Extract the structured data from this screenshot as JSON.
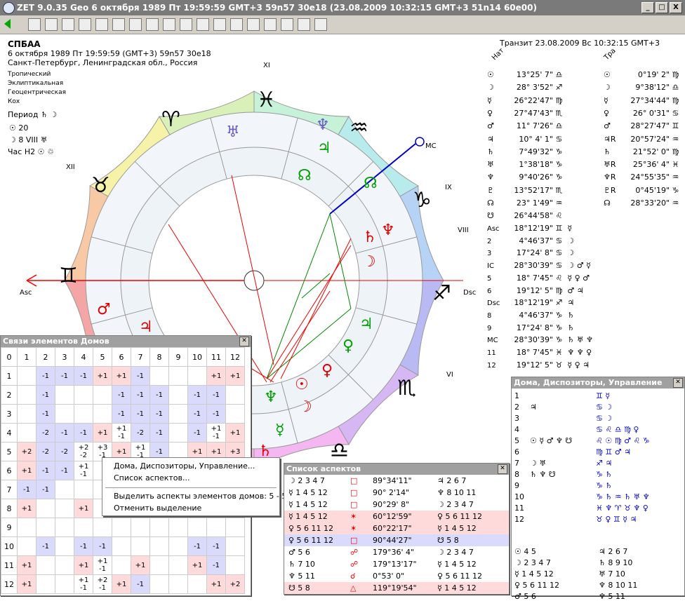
{
  "window": {
    "title": "ZET 9.0.35 Geo    6 октября 1989  Пт  19:59:59 GMT+3 59n57  30e18  (23.08.2009  10:32:15 GMT+3 51n14 60e00)",
    "min": "_",
    "max": "□",
    "close": "X"
  },
  "header": {
    "name": "СПБАА",
    "date_line": "6 октября 1989   Пт   19:59:59 (GMT+3)  59n57  30e18",
    "place": "Санкт-Петербург, Ленинградская обл., Россия",
    "settings": [
      "Тропический",
      "Эклиптикальная",
      "Геоцентрическая",
      "Кох"
    ],
    "period_label": "Период ♄ ☽",
    "sun_line": "☉  20",
    "moon_line": "☽  8 VIII ♅",
    "hour_label": "Час H2 ☉ ♲",
    "transit": "Транзит 23.08.2009   Вс 10:32:15 GMT+3"
  },
  "chart": {
    "houses": [
      "XI",
      "XII",
      "IX",
      "VIII",
      "VI"
    ],
    "asc": "Asc",
    "dsc": "Dsc",
    "mc": "MC",
    "signs": [
      "♓",
      "♈",
      "♉",
      "♊",
      "♒",
      "♑",
      "♐",
      "♏",
      "♎"
    ],
    "planets_green": [
      "♅",
      "♆",
      "♃",
      "☊",
      "☊",
      "♃",
      "♀",
      "♆",
      "☿"
    ],
    "planets_red": [
      "♆",
      "♄",
      "☽",
      "♂",
      "♃",
      "♀",
      "☉",
      "☽",
      "♄"
    ],
    "r": "R"
  },
  "positions": {
    "nat_header": "Нат",
    "tra_header": "Тра",
    "nat": [
      [
        "☉",
        "13°25' 7\"",
        "♎"
      ],
      [
        "☽",
        "28° 3'52\"",
        "♐"
      ],
      [
        "☿",
        "26°22'47\"",
        "♍"
      ],
      [
        "♀",
        "27°47'43\"",
        "♏"
      ],
      [
        "♂",
        "11° 7'26\"",
        "♎"
      ],
      [
        "♃",
        "10° 4' 1\"",
        "♋"
      ],
      [
        "♄",
        "7°49'32\"",
        "♑"
      ],
      [
        "♅",
        "1°38'18\"",
        "♑"
      ],
      [
        "♆",
        "9°40'26\"",
        "♑"
      ],
      [
        "♇",
        "13°52'17\"",
        "♏"
      ],
      [
        "☊",
        "23° 1'49\"",
        "♒"
      ],
      [
        "☋",
        "26°44'58\"",
        "♌"
      ]
    ],
    "tra": [
      [
        "☉",
        "0°19' 2\"",
        "♍"
      ],
      [
        "☽",
        "9°38'12\"",
        "♎"
      ],
      [
        "☿",
        "27°34'44\"",
        "♍"
      ],
      [
        "♀",
        "26° 0'31\"",
        "♋"
      ],
      [
        "♂",
        "28°27'47\"",
        "♊"
      ],
      [
        "♃R",
        "20°57'24\"",
        "♒"
      ],
      [
        "♄",
        "21°52' 0\"",
        "♍"
      ],
      [
        "♅R",
        "25°36' 4\"",
        "♓"
      ],
      [
        "♆R",
        "24°55'35\"",
        "♒"
      ],
      [
        "♇R",
        "0°45'19\"",
        "♑"
      ],
      [
        "☊",
        "28°33'20\"",
        "♒"
      ]
    ],
    "cusps": [
      [
        "Asc",
        "18°12'19\"",
        "♊",
        "☿"
      ],
      [
        "2",
        "4°46'37\"",
        "♋",
        "☽"
      ],
      [
        "3",
        "17°24' 8\"",
        "♋",
        "☽"
      ],
      [
        "IC",
        "28°30'39\"",
        "♋",
        "☽ ♂ ☿"
      ],
      [
        "5",
        "18° 7'45\"",
        "♌",
        "☿ ♀ ♂"
      ],
      [
        "6",
        "19°12' 5\"",
        "♍",
        "♂ ♃"
      ],
      [
        "Dsc",
        "18°12'19\"",
        "♐",
        "♃"
      ],
      [
        "8",
        "4°46'37\"",
        "♑",
        "♄"
      ],
      [
        "9",
        "17°24' 8\"",
        "♑",
        "♄"
      ],
      [
        "MC",
        "28°30'39\"",
        "♑",
        "♄ ♅ ♆"
      ],
      [
        "11",
        "18° 7'45\"",
        "♓",
        "♆ ♆ ♀"
      ],
      [
        "12",
        "19°12' 5\"",
        "♉",
        "☿ ♀ ♃"
      ]
    ]
  },
  "houses_panel": {
    "title": "Связи элементов Домов",
    "corner": "0",
    "cols": [
      "1",
      "2",
      "3",
      "4",
      "5",
      "6",
      "7",
      "8",
      "9",
      "10",
      "11",
      "12"
    ],
    "rows": [
      {
        "h": "1",
        "c": [
          [
            "",
            ""
          ],
          [
            "",
            "-1"
          ],
          [
            "",
            "-1"
          ],
          [
            "",
            "-1"
          ],
          [
            "+1",
            ""
          ],
          [
            "+1",
            ""
          ],
          [
            "",
            "-1"
          ],
          [
            "",
            ""
          ],
          [
            "",
            ""
          ],
          [
            "",
            ""
          ],
          [
            "+1",
            ""
          ],
          [
            "+1",
            ""
          ]
        ]
      },
      {
        "h": "2",
        "c": [
          [
            "",
            ""
          ],
          [
            "",
            "-1"
          ],
          [
            "",
            ""
          ],
          [
            "",
            ""
          ],
          [
            "",
            ""
          ],
          [
            "",
            "-1"
          ],
          [
            "",
            "-1"
          ],
          [
            "",
            "-1"
          ],
          [
            "",
            ""
          ],
          [
            "",
            "-1"
          ],
          [
            "",
            "-1"
          ],
          [
            "",
            ""
          ]
        ]
      },
      {
        "h": "3",
        "c": [
          [
            "",
            ""
          ],
          [
            "",
            "-1"
          ],
          [
            "",
            ""
          ],
          [
            "",
            ""
          ],
          [
            "",
            ""
          ],
          [
            "",
            "-1"
          ],
          [
            "",
            "-1"
          ],
          [
            "",
            "-1"
          ],
          [
            "",
            ""
          ],
          [
            "",
            "-1"
          ],
          [
            "",
            "-1"
          ],
          [
            "",
            ""
          ]
        ]
      },
      {
        "h": "4",
        "c": [
          [
            "",
            ""
          ],
          [
            "",
            "-2"
          ],
          [
            "",
            "-1"
          ],
          [
            "",
            "-1"
          ],
          [
            "+1",
            ""
          ],
          [
            "+1",
            "-1"
          ],
          [
            "",
            "-2"
          ],
          [
            "",
            "-1"
          ],
          [
            "",
            ""
          ],
          [
            "",
            "-1"
          ],
          [
            "+1",
            "-1"
          ],
          [
            "+1",
            ""
          ]
        ]
      },
      {
        "h": "5",
        "c": [
          [
            "+2",
            ""
          ],
          [
            "",
            "-2"
          ],
          [
            "",
            "-2"
          ],
          [
            "+2",
            "-2"
          ],
          [
            "+3",
            "-1"
          ],
          [
            "+1",
            ""
          ],
          [
            "+1",
            "-1"
          ],
          [
            "",
            "-1"
          ],
          [
            "",
            ""
          ],
          [
            "+1",
            ""
          ],
          [
            "+1",
            ""
          ],
          [
            "+3",
            ""
          ]
        ]
      },
      {
        "h": "6",
        "c": [
          [
            "+1",
            ""
          ],
          [
            "",
            "-1"
          ],
          [
            "",
            "-1"
          ],
          [
            "+1",
            "-1"
          ],
          [
            "",
            ""
          ],
          [
            "",
            ""
          ],
          [
            "",
            ""
          ],
          [
            "",
            ""
          ],
          [
            "",
            ""
          ],
          [
            "",
            ""
          ],
          [
            "",
            ""
          ],
          [
            "",
            ""
          ]
        ]
      },
      {
        "h": "7",
        "c": [
          [
            "",
            "-1"
          ],
          [
            "",
            "-1"
          ],
          [
            "",
            ""
          ],
          [
            "",
            ""
          ],
          [
            "",
            ""
          ],
          [
            "",
            ""
          ],
          [
            "",
            ""
          ],
          [
            "",
            ""
          ],
          [
            "",
            ""
          ],
          [
            "",
            ""
          ],
          [
            "",
            ""
          ],
          [
            "",
            ""
          ]
        ]
      },
      {
        "h": "8",
        "c": [
          [
            "+1",
            ""
          ],
          [
            "",
            ""
          ],
          [
            "",
            ""
          ],
          [
            "+1",
            ""
          ],
          [
            "",
            ""
          ],
          [
            "",
            ""
          ],
          [
            "",
            ""
          ],
          [
            "",
            ""
          ],
          [
            "",
            ""
          ],
          [
            "",
            ""
          ],
          [
            "",
            ""
          ],
          [
            "",
            ""
          ]
        ]
      },
      {
        "h": "9",
        "c": [
          [
            "",
            ""
          ],
          [
            "",
            ""
          ],
          [
            "",
            ""
          ],
          [
            "",
            ""
          ],
          [
            "",
            ""
          ],
          [
            "",
            ""
          ],
          [
            "",
            ""
          ],
          [
            "",
            ""
          ],
          [
            "",
            ""
          ],
          [
            "",
            ""
          ],
          [
            "",
            ""
          ],
          [
            "",
            ""
          ]
        ]
      },
      {
        "h": "10",
        "c": [
          [
            "",
            ""
          ],
          [
            "",
            "-1"
          ],
          [
            "",
            ""
          ],
          [
            "",
            "-1"
          ],
          [
            "",
            "-1"
          ],
          [
            "",
            ""
          ],
          [
            "",
            ""
          ],
          [
            "",
            ""
          ],
          [
            "",
            ""
          ],
          [
            "",
            "-1"
          ],
          [
            "",
            "-1"
          ],
          [
            "",
            ""
          ]
        ]
      },
      {
        "h": "11",
        "c": [
          [
            "+1",
            ""
          ],
          [
            "",
            ""
          ],
          [
            "",
            ""
          ],
          [
            "+1",
            ""
          ],
          [
            "+1",
            "-1"
          ],
          [
            "",
            ""
          ],
          [
            "+1",
            ""
          ],
          [
            "",
            ""
          ],
          [
            "",
            ""
          ],
          [
            "+1",
            ""
          ],
          [
            "",
            "-1"
          ],
          [
            "",
            ""
          ]
        ]
      },
      {
        "h": "12",
        "c": [
          [
            "+1",
            ""
          ],
          [
            "",
            ""
          ],
          [
            "",
            ""
          ],
          [
            "+1",
            "-1"
          ],
          [
            "+2",
            "-1"
          ],
          [
            "+1",
            ""
          ],
          [
            "",
            "-1"
          ],
          [
            "",
            ""
          ],
          [
            "",
            ""
          ],
          [
            "",
            ""
          ],
          [
            "+1",
            ""
          ],
          [
            "+2",
            ""
          ]
        ]
      }
    ]
  },
  "context_menu": {
    "item1": "Дома, Диспозиторы, Управление...",
    "item2": "Список аспектов...",
    "item3": "Выделить аспекты элементов домов: 5 - 5",
    "item4": "Отменить выделение"
  },
  "aspects_panel": {
    "title": "Список аспектов",
    "rows": [
      [
        "☽ 2 3 4 7",
        "□",
        "89°34'11\"",
        "♃ 2 6 7",
        ""
      ],
      [
        "☿ 1 4 5 12",
        "□",
        "90° 2'14\"",
        "♆ 8 10 11",
        ""
      ],
      [
        "☿ 1 4 5 12",
        "□",
        "90°29' 8\"",
        "☽ 2 3 4 7",
        ""
      ],
      [
        "☿ 1 4 5 12",
        "✶",
        "60°12'59\"",
        "♀ 5 6 11 12",
        "pos"
      ],
      [
        "♀ 5 6 11 12",
        "✶",
        "60°22'17\"",
        "☿ 1 4 5 12",
        "pos"
      ],
      [
        "♀ 5 6 11 12",
        "□",
        "90°44'27\"",
        "☋ 5 8",
        "neg"
      ],
      [
        "♂ 5 6",
        "☍",
        "179°36' 4\"",
        "☽ 2 3 4 7",
        ""
      ],
      [
        "♄ 7 10",
        "☍",
        "179°13'17\"",
        "☿ 1 4 5 12",
        ""
      ],
      [
        "♆ 5 11",
        "☌",
        "0°53' 0\"",
        "♀ 5 6 11 12",
        ""
      ],
      [
        "☋ 5 8",
        "△",
        "119°19'54\"",
        "☿ 1 4 5 12",
        "pos"
      ]
    ]
  },
  "disp_panel": {
    "title": "Дома, Диспозиторы, Управление",
    "rows": [
      [
        "1",
        "♊ ☿"
      ],
      [
        "2",
        "♃",
        "♋ ☽"
      ],
      [
        "3",
        "",
        "♋ ☽"
      ],
      [
        "4",
        "",
        "♋ ♌ ♎ ♍ ♀"
      ],
      [
        "5",
        "☉ ☿ ♂ ♆ ☋",
        "♌ ☉ ♍ ♂ ♌ ♑"
      ],
      [
        "6",
        "",
        "♍ ♊ ♂ ♃"
      ],
      [
        "7",
        "☽ ♅",
        "♐ ♃"
      ],
      [
        "8",
        "♄ ♆ ☋",
        "♑ ♄"
      ],
      [
        "9",
        "",
        "♑ ♄"
      ],
      [
        "10",
        "",
        "♑ ♄ ♒ ♄ ♅ ♆"
      ],
      [
        "11",
        "",
        "♓ ♆ ♈ ♉ ♆ ♀"
      ],
      [
        "12",
        "",
        "♉ ♀ ♊ ☿ ♃"
      ]
    ],
    "bottom": [
      [
        "☉  4 5",
        "♃  2 6 7"
      ],
      [
        "☽  2 3 4 7",
        "♄  8 9 10"
      ],
      [
        "☿  1 4 5 12",
        "♅  7 10"
      ],
      [
        "♀  5 6 11 12",
        "♆  8 10 11"
      ],
      [
        "♂  5 6",
        "♆  5 11"
      ]
    ]
  },
  "colors": {
    "pos": "#ffdada",
    "neg": "#dadafc",
    "green": "#00a000",
    "red": "#e00000",
    "blue": "#0000cc"
  }
}
